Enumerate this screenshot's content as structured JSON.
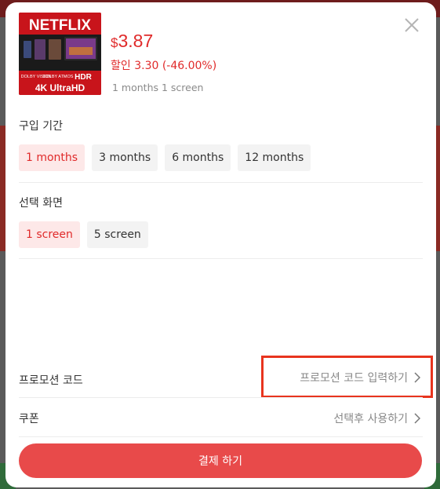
{
  "product": {
    "logo_text": "NETFLIX",
    "badges": [
      "DOLBY VISION",
      "DOLBY ATMOS",
      "HDR"
    ],
    "resolution": "4K UltraHD",
    "currency": "$",
    "price": "3.87",
    "discount": "할인 3.30 (-46.00%)",
    "summary": "1 months 1 screen"
  },
  "period": {
    "title": "구입 기간",
    "options": [
      "1 months",
      "3 months",
      "6 months",
      "12 months"
    ],
    "selected": "1 months"
  },
  "screens": {
    "title": "선택 화면",
    "options": [
      "1 screen",
      "5 screen"
    ],
    "selected": "1 screen"
  },
  "promo": {
    "label": "프로모션 코드",
    "value": "프로모션 코드 입력하기"
  },
  "coupon": {
    "label": "쿠폰",
    "value": "선택후 사용하기"
  },
  "pay_button": "결제 하기",
  "colors": {
    "accent": "#e02a2a",
    "button": "#e84a4a",
    "highlight_box": "#e8341e",
    "netflix_red": "#c8141b"
  },
  "icons": {
    "close": "close-icon",
    "chevron": "chevron-right-icon"
  }
}
